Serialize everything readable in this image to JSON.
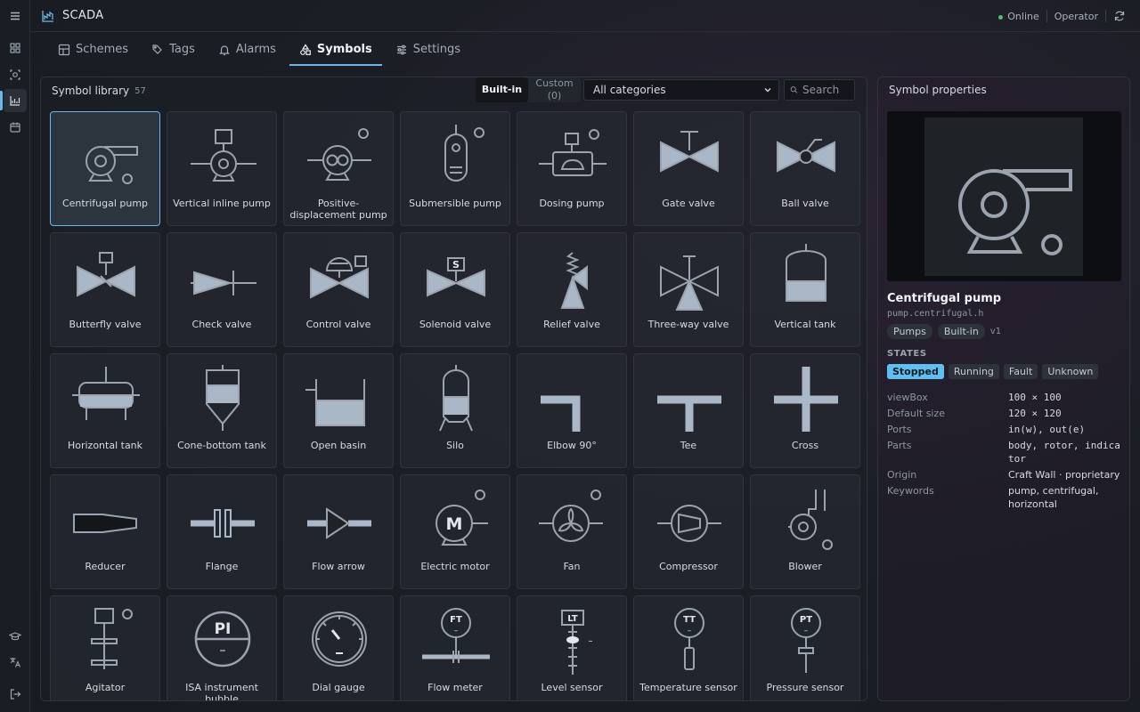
{
  "app": {
    "title": "SCADA"
  },
  "top": {
    "status": "Online",
    "user": "Operator"
  },
  "tabs": [
    {
      "label": "Schemes",
      "icon": "layout-icon"
    },
    {
      "label": "Tags",
      "icon": "tags-icon"
    },
    {
      "label": "Alarms",
      "icon": "bell-icon"
    },
    {
      "label": "Symbols",
      "icon": "shapes-icon",
      "active": true
    },
    {
      "label": "Settings",
      "icon": "sliders-icon"
    }
  ],
  "library": {
    "title": "Symbol library",
    "count": "57",
    "source_builtin": "Built-in",
    "source_custom": "Custom (0)",
    "category": "All categories",
    "search_placeholder": "Search",
    "symbols": [
      "Centrifugal pump",
      "Vertical inline pump",
      "Positive-displacement pump",
      "Submersible pump",
      "Dosing pump",
      "Gate valve",
      "Ball valve",
      "Butterfly valve",
      "Check valve",
      "Control valve",
      "Solenoid valve",
      "Relief valve",
      "Three-way valve",
      "Vertical tank",
      "Horizontal tank",
      "Cone-bottom tank",
      "Open basin",
      "Silo",
      "Elbow 90°",
      "Tee",
      "Cross",
      "Reducer",
      "Flange",
      "Flow arrow",
      "Electric motor",
      "Fan",
      "Compressor",
      "Blower",
      "Agitator",
      "ISA instrument bubble",
      "Dial gauge",
      "Flow meter",
      "Level sensor",
      "Temperature sensor",
      "Pressure sensor"
    ],
    "glyphs": {
      "solenoid": "S",
      "motor": "M",
      "isa_top": "PI",
      "isa_bottom": "–",
      "flow_meter": "FT",
      "level": "LT",
      "temperature": "TT",
      "pressure": "PT",
      "dash": "–"
    }
  },
  "properties": {
    "title": "Symbol properties",
    "name": "Centrifugal pump",
    "id": "pump.centrifugal.h",
    "category_chip": "Pumps",
    "source_chip": "Built-in",
    "version": "v1",
    "states_label": "STATES",
    "states": [
      "Stopped",
      "Running",
      "Fault",
      "Unknown"
    ],
    "fields": [
      {
        "key": "viewBox",
        "value": "100 × 100"
      },
      {
        "key": "Default size",
        "value": "120 × 120"
      },
      {
        "key": "Ports",
        "value": "in(w), out(e)"
      },
      {
        "key": "Parts",
        "value": "body, rotor, indicator"
      },
      {
        "key": "Origin",
        "value": "Craft Wall · proprietary"
      },
      {
        "key": "Keywords",
        "value": "pump, centrifugal, horizontal"
      }
    ]
  },
  "colors": {
    "accent": "#6ab7e8",
    "stroke": "#9aa3ae",
    "fill": "#a9b7c6",
    "state_active": "#5ec0f0"
  }
}
